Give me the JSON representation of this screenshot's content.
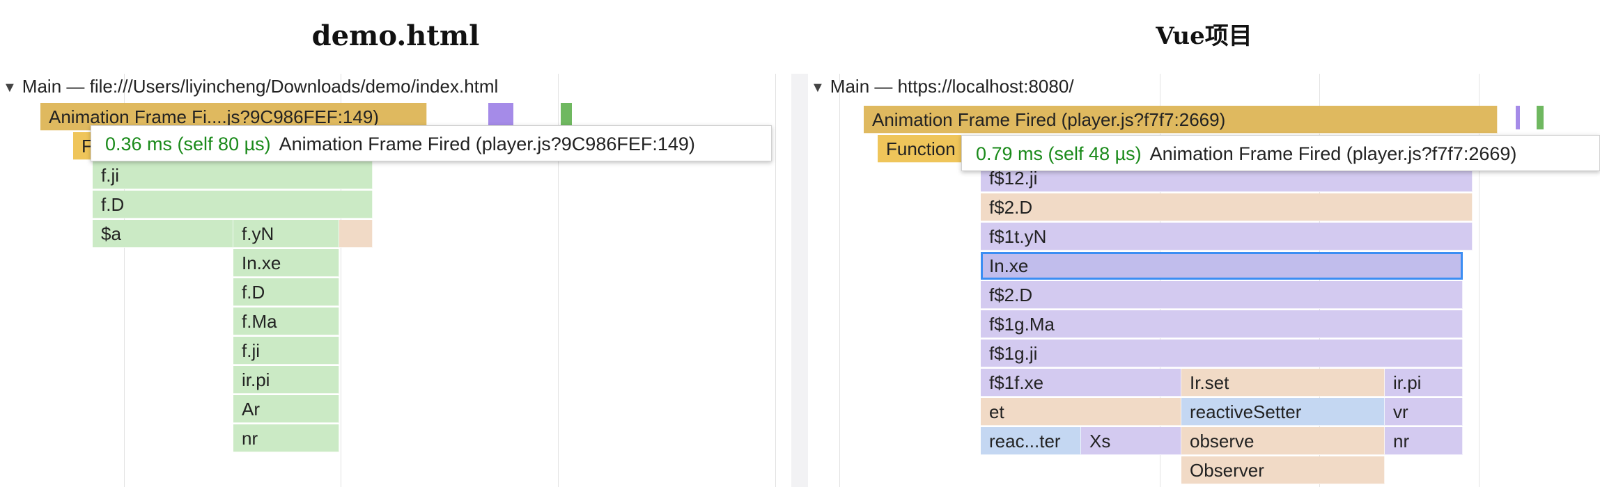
{
  "colors": {
    "animation": "#dfb95f",
    "green_frame": "#cbeac5",
    "peach_frame": "#f1dac6",
    "lavender_frame": "#d3caf0",
    "blue_frame": "#c4d7f2",
    "selected_frame": "#c1bdec",
    "purple_mark": "#a58be8",
    "green_mark": "#6fb860",
    "tooltip_time": "#1a8a1a"
  },
  "left": {
    "caption": "demo.html",
    "track_header": "Main — file:///Users/liyincheng/Downloads/demo/index.html",
    "frames": [
      "Animation Frame Fi....js?9C986FEF:149)",
      "F",
      "f.ji",
      "f.D",
      "$a",
      "f.yN",
      "In.xe",
      "f.D",
      "f.Ma",
      "f.ji",
      "ir.pi",
      "Ar",
      "nr"
    ],
    "tooltip": {
      "time": "0.36 ms (self 80 µs)",
      "label": "Animation Frame Fired (player.js?9C986FEF:149)"
    }
  },
  "right": {
    "caption": "Vue项目",
    "track_header": "Main — https://localhost:8080/",
    "frames": [
      "Animation Frame Fired (player.js?f7f7:2669)",
      "Function",
      "f$12.ji",
      "f$2.D",
      "f$1t.yN",
      "In.xe",
      "f$2.D",
      "f$1g.Ma",
      "f$1g.ji",
      "f$1f.xe",
      "Ir.set",
      "ir.pi",
      "et",
      "reactiveSetter",
      "vr",
      "reac...ter",
      "Xs",
      "observe",
      "nr",
      "Observer"
    ],
    "tooltip": {
      "time": "0.79 ms (self 48 µs)",
      "label": "Animation Frame Fired (player.js?f7f7:2669)"
    }
  }
}
